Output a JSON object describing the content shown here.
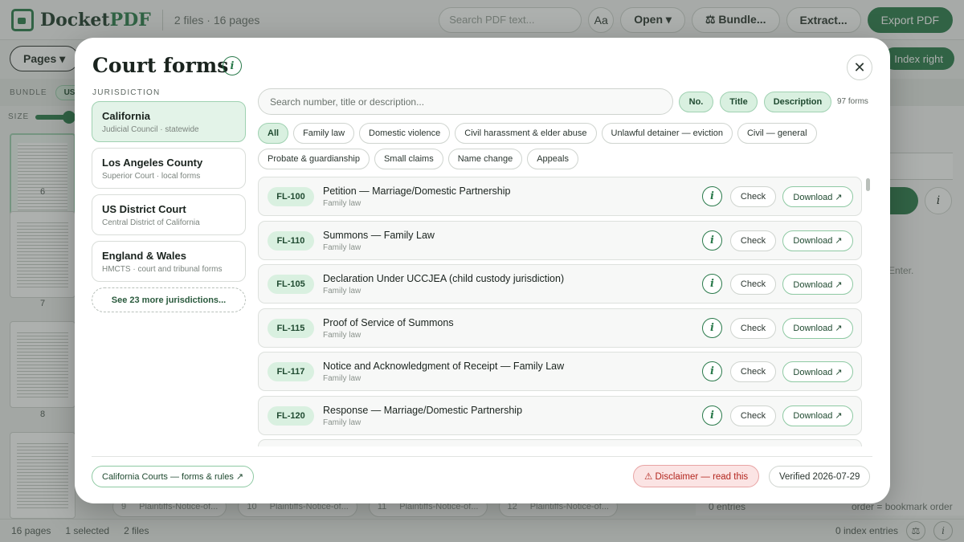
{
  "app": {
    "logo_text_a": "Docket",
    "logo_text_b": "PDF",
    "meta": "2 files · 16 pages",
    "search_placeholder": "Search PDF text...",
    "aa_label": "Aa",
    "open_label": "Open ▾",
    "bundle_label": "⚖ Bundle...",
    "extract_label": "Extract...",
    "export_label": "Export PDF",
    "pages_label": "Pages ▾",
    "index_right_label": "Index right",
    "bundle_row_label": "BUNDLE",
    "bundle_chip": "US",
    "size_label": "SIZE",
    "thumb_numbers": [
      "6",
      "7",
      "8"
    ],
    "right_hint": "Enter.",
    "entries_label": "0 entries",
    "order_label": "order = bookmark order",
    "bottom_chips": [
      {
        "num": "9",
        "name": "Plaintiffs-Notice-of..."
      },
      {
        "num": "10",
        "name": "Plaintiffs-Notice-of..."
      },
      {
        "num": "11",
        "name": "Plaintiffs-Notice-of..."
      },
      {
        "num": "12",
        "name": "Plaintiffs-Notice-of..."
      }
    ],
    "status": {
      "pages": "16 pages",
      "selected": "1 selected",
      "files": "2 files",
      "index_entries": "0 index entries"
    }
  },
  "modal": {
    "title": "Court forms",
    "info_glyph": "i",
    "close_glyph": "✕",
    "jurisdiction_label": "JURISDICTION",
    "jurisdictions": [
      {
        "name": "California",
        "sub": "Judicial Council · statewide"
      },
      {
        "name": "Los Angeles County",
        "sub": "Superior Court · local forms"
      },
      {
        "name": "US District Court",
        "sub": "Central District of California"
      },
      {
        "name": "England & Wales",
        "sub": "HMCTS · court and tribunal forms"
      }
    ],
    "more_jurisdictions": "See 23 more jurisdictions...",
    "search_placeholder": "Search number, title or description...",
    "field_chips": [
      "No.",
      "Title",
      "Description"
    ],
    "count": "97 forms",
    "categories_row1": [
      "All",
      "Family law",
      "Domestic violence",
      "Civil harassment & elder abuse",
      "Unlawful detainer — eviction",
      "Civil — general"
    ],
    "categories_row2": [
      "Probate & guardianship",
      "Small claims",
      "Name change",
      "Appeals"
    ],
    "forms": [
      {
        "code": "FL-100",
        "title": "Petition — Marriage/Domestic Partnership",
        "category": "Family law"
      },
      {
        "code": "FL-110",
        "title": "Summons — Family Law",
        "category": "Family law"
      },
      {
        "code": "FL-105",
        "title": "Declaration Under UCCJEA (child custody jurisdiction)",
        "category": "Family law"
      },
      {
        "code": "FL-115",
        "title": "Proof of Service of Summons",
        "category": "Family law"
      },
      {
        "code": "FL-117",
        "title": "Notice and Acknowledgment of Receipt — Family Law",
        "category": "Family law"
      },
      {
        "code": "FL-120",
        "title": "Response — Marriage/Domestic Partnership",
        "category": "Family law"
      }
    ],
    "check_label": "Check",
    "download_label": "Download ↗",
    "footer_link": "California Courts — forms & rules ↗",
    "disclaimer": "⚠ Disclaimer — read this",
    "verified": "Verified 2026-07-29"
  },
  "colors": {
    "brand": "#2a7a4b",
    "chip_bg": "#d9f0e0",
    "disclaimer_bg": "#fbe4e4",
    "disclaimer_text": "#b3261e"
  }
}
